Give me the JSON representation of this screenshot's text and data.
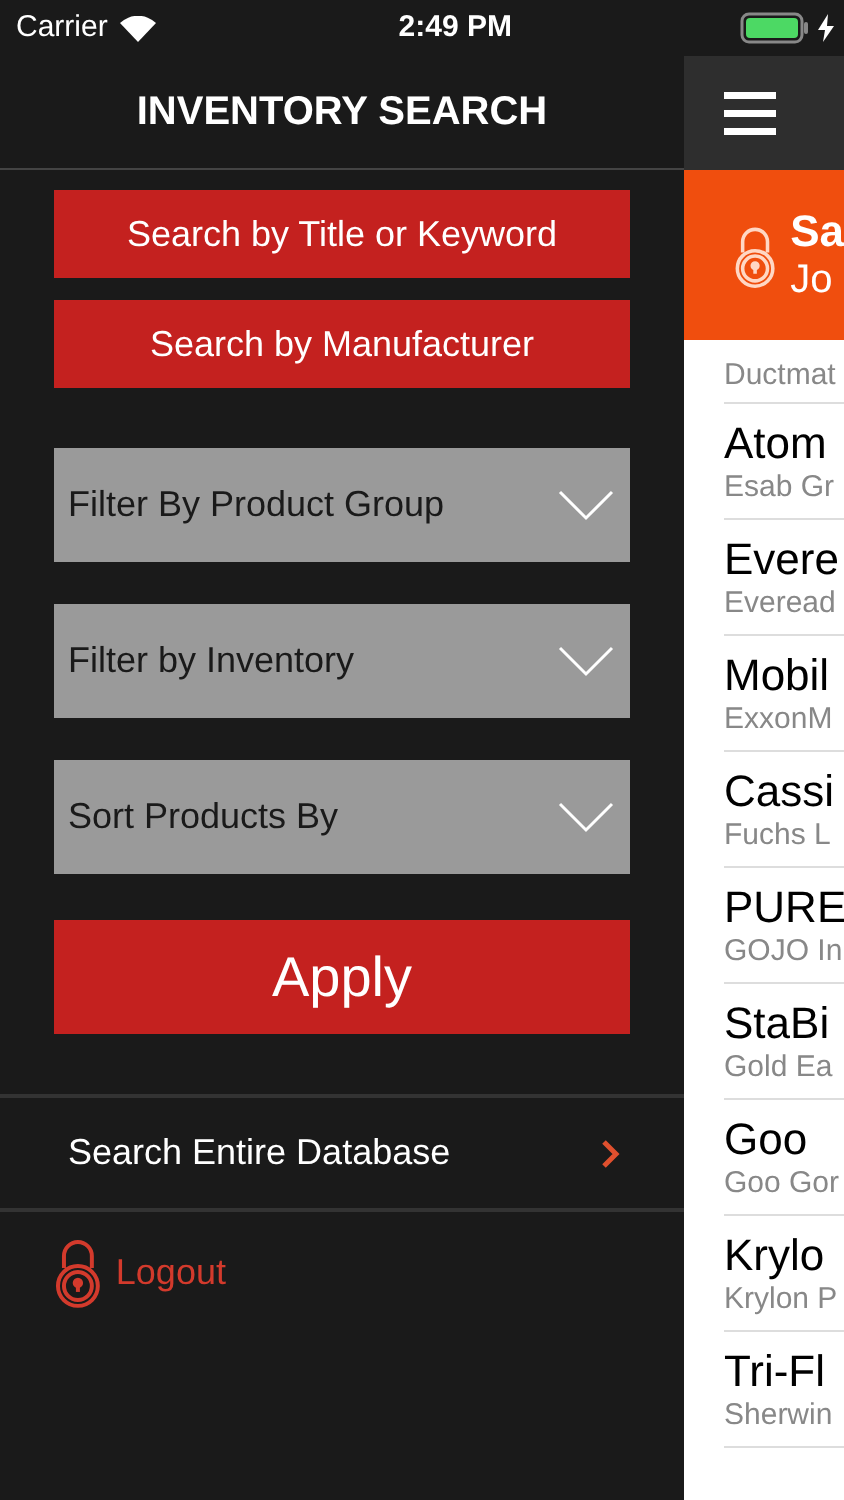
{
  "status_bar": {
    "carrier": "Carrier",
    "time": "2:49 PM"
  },
  "menu": {
    "title": "INVENTORY SEARCH",
    "search_buttons": [
      "Search by Title or Keyword",
      "Search by Manufacturer"
    ],
    "filters": [
      {
        "label": "Filter By Product Group"
      },
      {
        "label": "Filter by Inventory"
      },
      {
        "label": "Sort Products By"
      }
    ],
    "apply_button": "Apply",
    "links": [
      {
        "kind": "chevron",
        "label": "Search Entire Database"
      },
      {
        "kind": "logout",
        "label": "Logout"
      }
    ]
  },
  "main": {
    "banner": {
      "title": "Sa",
      "subtitle": "Jo"
    },
    "rows": [
      {
        "subtitle": "Ductmat"
      },
      {
        "title": "Atom",
        "subtitle": "Esab Gr"
      },
      {
        "title": "Evere",
        "subtitle": "Everead"
      },
      {
        "title": "Mobil",
        "subtitle": "ExxonM"
      },
      {
        "title": "Cassi",
        "subtitle": "Fuchs L"
      },
      {
        "title": "PURE",
        "subtitle": "GOJO In"
      },
      {
        "title": "StaBi",
        "subtitle": "Gold Ea"
      },
      {
        "title": "Goo",
        "subtitle": "Goo Gor"
      },
      {
        "title": "Krylo",
        "subtitle": "Krylon P"
      },
      {
        "title": "Tri-Fl",
        "subtitle": "Sherwin"
      }
    ]
  }
}
